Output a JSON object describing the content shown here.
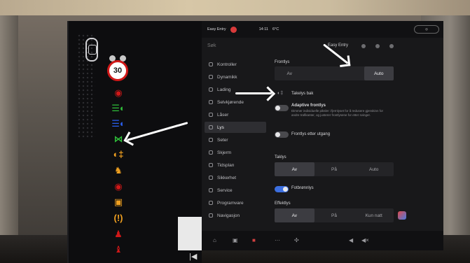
{
  "strip": {
    "speed_limit": "30"
  },
  "statusbar": {
    "profile": "Easy Entry",
    "clock": "14:11",
    "temp": "6°C"
  },
  "topbar": {
    "search_placeholder": "Søk",
    "profile_title": "Easy Entry"
  },
  "sidebar": {
    "items": [
      {
        "label": "Kontroller"
      },
      {
        "label": "Dynamikk"
      },
      {
        "label": "Lading"
      },
      {
        "label": "Selvkjørende"
      },
      {
        "label": "Låser"
      },
      {
        "label": "Lys"
      },
      {
        "label": "Seter"
      },
      {
        "label": "Skjerm"
      },
      {
        "label": "Tidsplan"
      },
      {
        "label": "Sikkerhet"
      },
      {
        "label": "Service"
      },
      {
        "label": "Programvare"
      },
      {
        "label": "Navigasjon"
      }
    ],
    "active_index": 5
  },
  "content": {
    "frontlys": {
      "label": "Frontlys",
      "options": [
        "Av",
        "Auto"
      ],
      "selected": "Auto"
    },
    "taklys_bak": "Takelys bak",
    "adaptive": {
      "title": "Adaptive frontlys",
      "desc": "Dimmer individuelle piksler i fjernlyset for å redusere gjenskinn for andre trafikanter, og justerer frontlysene for etter svinger."
    },
    "frontlys_etter": "Frontlys etter utgang",
    "taklys": {
      "label": "Taklys",
      "options": [
        "Av",
        "På",
        "Auto"
      ],
      "selected": "Av"
    },
    "fotbronnlys": "Fotbrønnlys",
    "effektlys": {
      "label": "Effektlys",
      "options": [
        "Av",
        "På",
        "Kun natt"
      ],
      "selected": "Av"
    }
  },
  "colors": {
    "accent": "#3c6fe0",
    "warning_red": "#d01818",
    "tell_green": "#2fbf3a",
    "tell_blue": "#2a5ff0",
    "tell_orange": "#f0a020"
  }
}
